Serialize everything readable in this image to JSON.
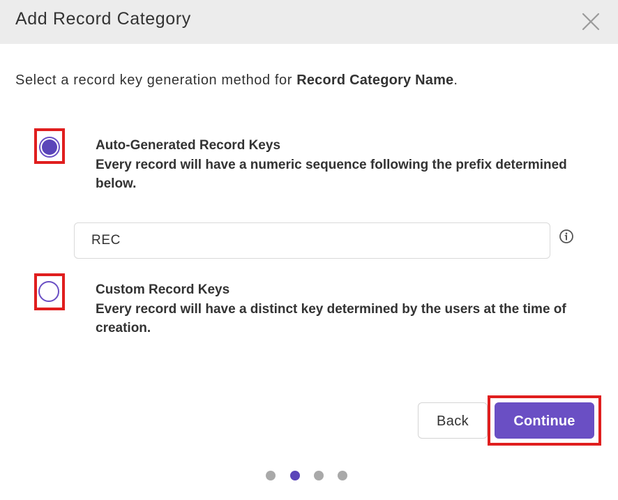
{
  "dialog": {
    "title": "Add Record Category",
    "close_icon": "close-icon"
  },
  "prompt": {
    "text_before": "Select a record key generation method for ",
    "bold_name": "Record Category Name",
    "text_after": "."
  },
  "options": [
    {
      "title": "Auto-Generated Record Keys",
      "description": "Every record will have a numeric sequence following the prefix determined below.",
      "selected": true
    },
    {
      "title": "Custom Record Keys",
      "description": "Every record will have a distinct key determined by the users at the time of creation.",
      "selected": false
    }
  ],
  "prefix_input": {
    "value": "REC",
    "info_icon": "info-icon"
  },
  "buttons": {
    "back_label": "Back",
    "continue_label": "Continue"
  },
  "stepper": {
    "total_steps": 4,
    "current_step": 2
  },
  "colors": {
    "accent": "#6a4fc4",
    "highlight": "#e01e1e",
    "header_bg": "#ececec"
  }
}
